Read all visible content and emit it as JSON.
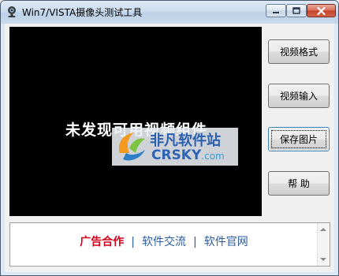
{
  "window": {
    "title": "Win7/VISTA摄像头测试工具",
    "app_icon": "webcam-icon",
    "controls": {
      "minimize_icon": "minimize-icon",
      "maximize_icon": "maximize-icon",
      "close_icon": "close-icon"
    }
  },
  "video": {
    "message": "未发现可用视频组件",
    "background_color": "#000000"
  },
  "watermark": {
    "name": "非凡软件站",
    "brand": "CRSKY",
    "suffix": ".com"
  },
  "buttons": {
    "video_format": "视频格式",
    "video_input": "视频输入",
    "save_image": "保存图片",
    "help": "帮 助"
  },
  "links": {
    "ad": "广告合作",
    "separator": "|",
    "software_exchange": "软件交流",
    "official_site": "软件官网",
    "ad_color": "#d0021b",
    "link_color": "#2c5ba0"
  }
}
